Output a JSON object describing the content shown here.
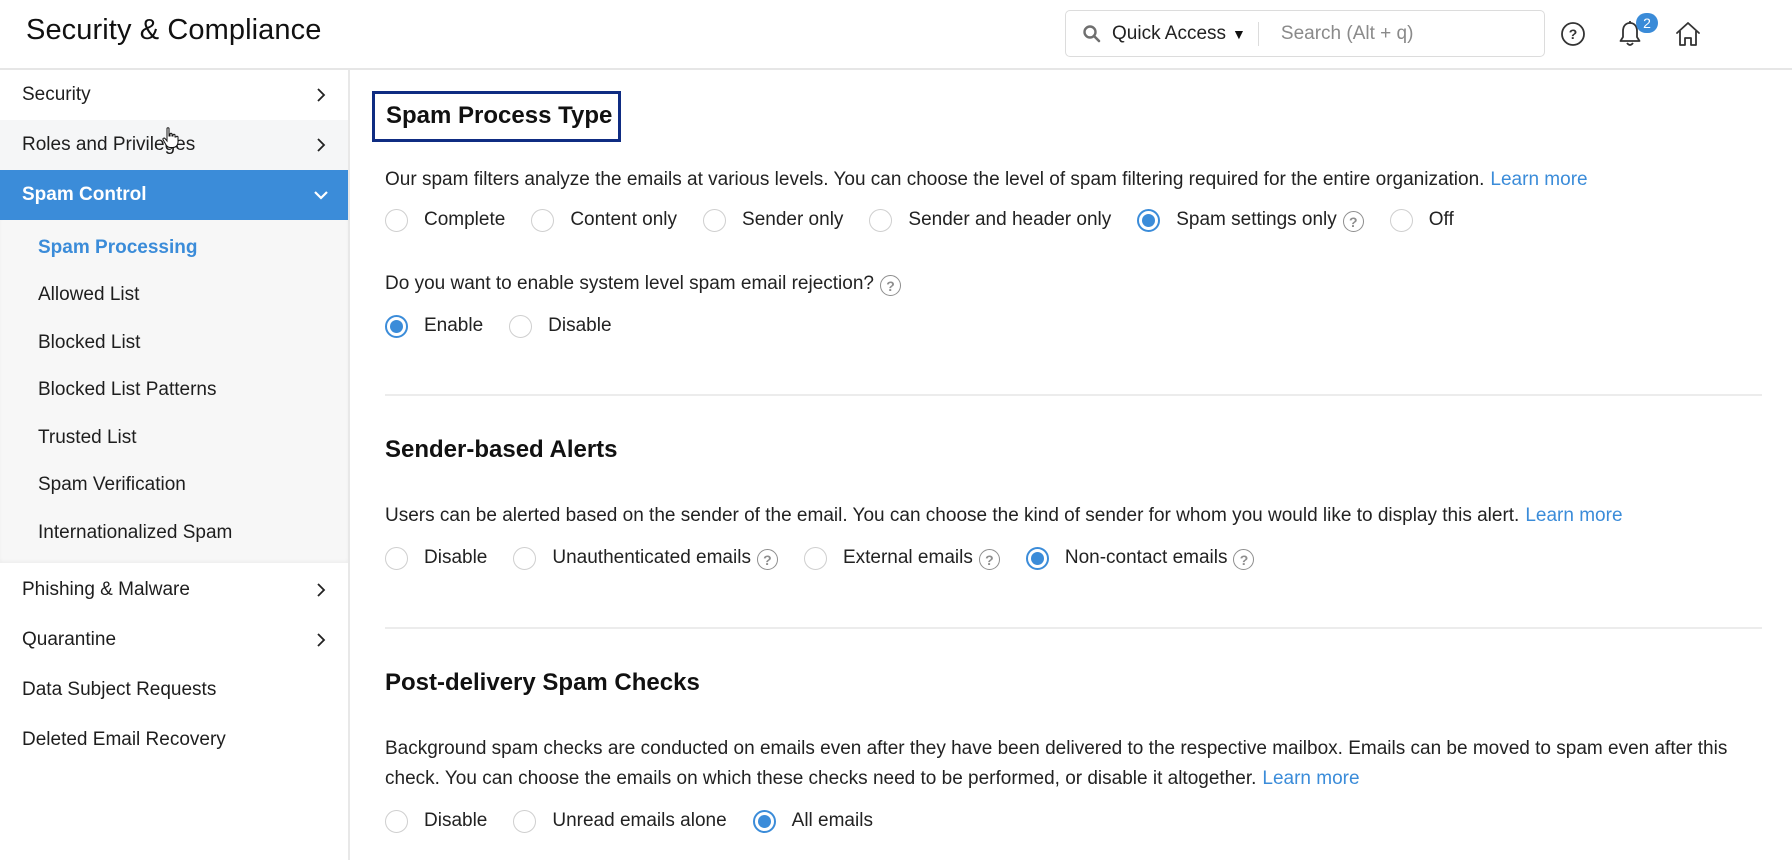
{
  "header": {
    "title": "Security & Compliance",
    "quick_access_label": "Quick Access",
    "search_placeholder": "Search (Alt + q)",
    "notification_count": "2",
    "icons": [
      "search-icon",
      "caret-down-icon",
      "help-icon",
      "bell-icon",
      "home-icon"
    ]
  },
  "sidebar": {
    "items": [
      {
        "label": "Security",
        "has_chevron": true
      },
      {
        "label": "Roles and Privileges",
        "has_chevron": true,
        "hovered": true
      },
      {
        "label": "Spam Control",
        "has_chevron": true,
        "expanded": true,
        "active": true
      }
    ],
    "spam_control_submenu": [
      {
        "label": "Spam Processing",
        "current": true
      },
      {
        "label": "Allowed List"
      },
      {
        "label": "Blocked List"
      },
      {
        "label": "Blocked List Patterns"
      },
      {
        "label": "Trusted List"
      },
      {
        "label": "Spam Verification"
      },
      {
        "label": "Internationalized Spam"
      }
    ],
    "items_after": [
      {
        "label": "Phishing & Malware",
        "has_chevron": true
      },
      {
        "label": "Quarantine",
        "has_chevron": true
      },
      {
        "label": "Data Subject Requests",
        "has_chevron": false
      },
      {
        "label": "Deleted Email Recovery",
        "has_chevron": false
      }
    ]
  },
  "main": {
    "spam_process_type": {
      "title": "Spam Process Type",
      "description": "Our spam filters analyze the emails at various levels. You can choose the level of spam filtering required for the entire organization.",
      "learn_more": "Learn more",
      "options": [
        {
          "label": "Complete",
          "checked": false
        },
        {
          "label": "Content only",
          "checked": false
        },
        {
          "label": "Sender only",
          "checked": false
        },
        {
          "label": "Sender and header only",
          "checked": false
        },
        {
          "label": "Spam settings only",
          "checked": true,
          "help": true
        },
        {
          "label": "Off",
          "checked": false
        }
      ],
      "rejection_question": "Do you want to enable system level spam email rejection?",
      "rejection_options": [
        {
          "label": "Enable",
          "checked": true
        },
        {
          "label": "Disable",
          "checked": false
        }
      ]
    },
    "sender_alerts": {
      "title": "Sender-based Alerts",
      "description": "Users can be alerted based on the sender of the email. You can choose the kind of sender for whom you would like to display this alert.",
      "learn_more": "Learn more",
      "options": [
        {
          "label": "Disable",
          "checked": false
        },
        {
          "label": "Unauthenticated emails",
          "checked": false,
          "help": true
        },
        {
          "label": "External emails",
          "checked": false,
          "help": true
        },
        {
          "label": "Non-contact emails",
          "checked": true,
          "help": true
        }
      ]
    },
    "post_delivery": {
      "title": "Post-delivery Spam Checks",
      "description": "Background spam checks are conducted on emails even after they have been delivered to the respective mailbox. Emails can be moved to spam even after this check. You can choose the emails on which these checks need to be performed, or disable it altogether.",
      "learn_more": "Learn more",
      "options": [
        {
          "label": "Disable",
          "checked": false
        },
        {
          "label": "Unread emails alone",
          "checked": false
        },
        {
          "label": "All emails",
          "checked": true
        }
      ]
    }
  },
  "colors": {
    "accent": "#3b8cd9",
    "focus_outline": "#0f2c82",
    "hover_bg": "#f5f6f7",
    "submenu_bg": "#f7f7f7"
  }
}
